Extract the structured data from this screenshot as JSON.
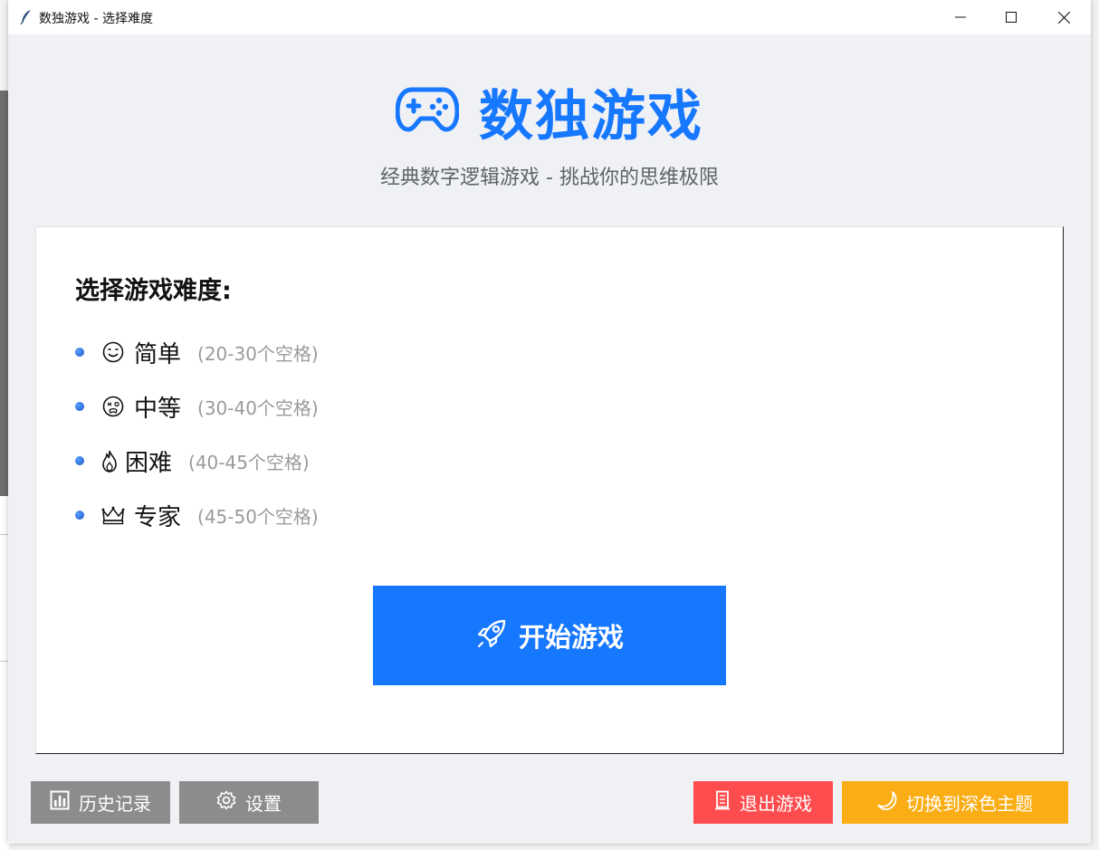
{
  "window": {
    "title": "数独游戏 - 选择难度"
  },
  "header": {
    "title": "数独游戏",
    "subtitle": "经典数字逻辑游戏 - 挑战你的思维极限"
  },
  "difficulty": {
    "heading": "选择游戏难度:",
    "options": [
      {
        "label": "简单",
        "range": "(20-30个空格)",
        "icon": "smile-icon"
      },
      {
        "label": "中等",
        "range": "(30-40个空格)",
        "icon": "dizzy-face-icon"
      },
      {
        "label": "困难",
        "range": "(40-45个空格)",
        "icon": "fire-icon"
      },
      {
        "label": "专家",
        "range": "(45-50个空格)",
        "icon": "crown-icon"
      }
    ]
  },
  "actions": {
    "start_label": "开始游戏",
    "history_label": "历史记录",
    "settings_label": "设置",
    "exit_label": "退出游戏",
    "theme_label": "切换到深色主题"
  },
  "colors": {
    "primary": "#1677ff",
    "gray_button": "#8c8c8c",
    "exit_button": "#ff4d4f",
    "theme_button": "#faad14",
    "background": "#f0f1f5"
  }
}
